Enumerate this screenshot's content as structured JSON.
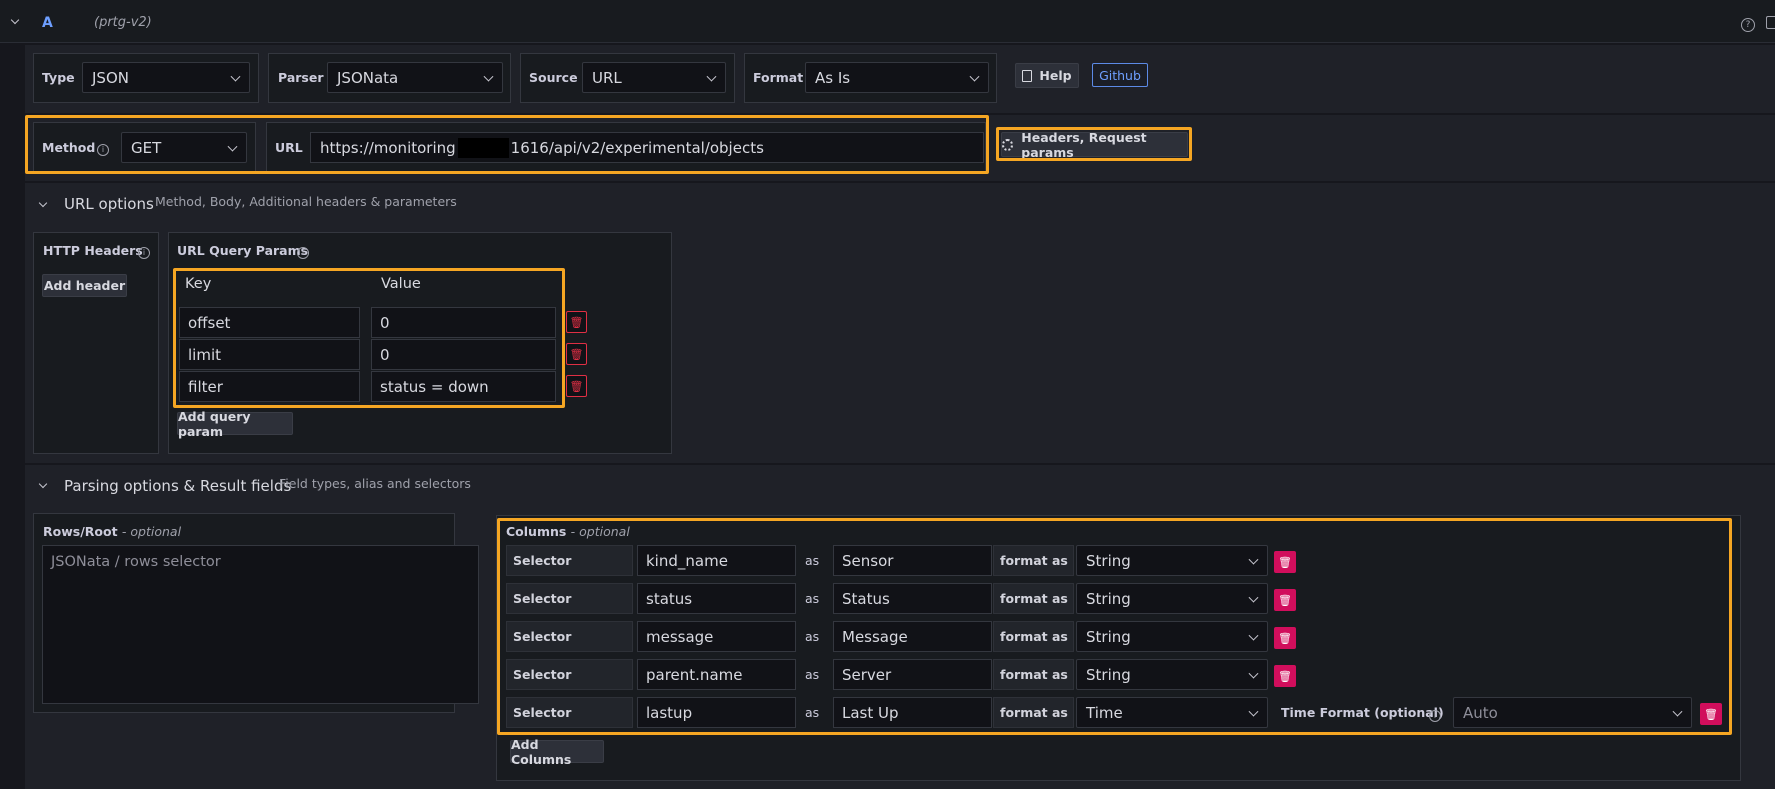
{
  "query": {
    "collapse_icon": "chevron-down-icon",
    "ref_id": "A",
    "datasource": "(prtg-v2)"
  },
  "type_row": {
    "type_label": "Type",
    "type_value": "JSON",
    "parser_label": "Parser",
    "parser_value": "JSONata",
    "source_label": "Source",
    "source_value": "URL",
    "format_label": "Format",
    "format_value": "As Is",
    "help_label": "Help",
    "github_label": "Github"
  },
  "request_row": {
    "method_label": "Method",
    "method_value": "GET",
    "url_label": "URL",
    "url_value_prefix": "https://monitoring",
    "url_value_suffix": "1616/api/v2/experimental/objects",
    "headers_button": "Headers, Request params"
  },
  "url_options": {
    "title": "URL options",
    "subtitle": "Method, Body, Additional headers & parameters",
    "http_headers_label": "HTTP Headers",
    "add_header": "Add header",
    "query_params_label": "URL Query Params",
    "key_header": "Key",
    "value_header": "Value",
    "params": [
      {
        "key": "offset",
        "value": "0"
      },
      {
        "key": "limit",
        "value": "0"
      },
      {
        "key": "filter",
        "value": "status = down"
      }
    ],
    "add_query_param": "Add query param"
  },
  "parsing": {
    "title": "Parsing options & Result fields",
    "subtitle": "Field types, alias and selectors",
    "rows_root_label": "Rows/Root",
    "rows_root_optional": "- optional",
    "rows_root_placeholder": "JSONata / rows selector",
    "columns_label": "Columns",
    "columns_optional": "- optional",
    "selector_label": "Selector",
    "as_label": "as",
    "format_as_label": "format as",
    "columns": [
      {
        "selector": "kind_name",
        "alias": "Sensor",
        "format": "String"
      },
      {
        "selector": "status",
        "alias": "Status",
        "format": "String"
      },
      {
        "selector": "message",
        "alias": "Message",
        "format": "String"
      },
      {
        "selector": "parent.name",
        "alias": "Server",
        "format": "String"
      },
      {
        "selector": "lastup",
        "alias": "Last Up",
        "format": "Time"
      }
    ],
    "time_format_label": "Time Format (optional)",
    "time_format_value": "Auto",
    "add_columns": "Add Columns"
  },
  "colors": {
    "highlight": "#f5a623",
    "delete": "#d10e5c",
    "github_border": "#5c8ae6"
  }
}
